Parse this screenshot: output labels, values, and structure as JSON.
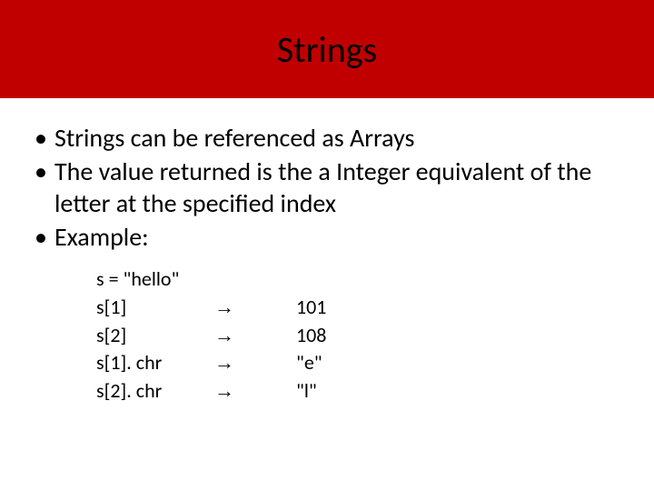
{
  "title": "Strings",
  "bullets": [
    "Strings can be referenced as Arrays",
    "The value returned is the a Integer equivalent of the letter at the specified index",
    "Example:"
  ],
  "example": {
    "init": "s = \"hello\"",
    "rows": [
      {
        "expr": "s[1]",
        "arrow": "→",
        "val": "101"
      },
      {
        "expr": "s[2]",
        "arrow": "→",
        "val": "108"
      },
      {
        "expr": "s[1]. chr",
        "arrow": "→",
        "val": "\"e\""
      },
      {
        "expr": "s[2]. chr",
        "arrow": "→",
        "val": "\"l\""
      }
    ]
  }
}
